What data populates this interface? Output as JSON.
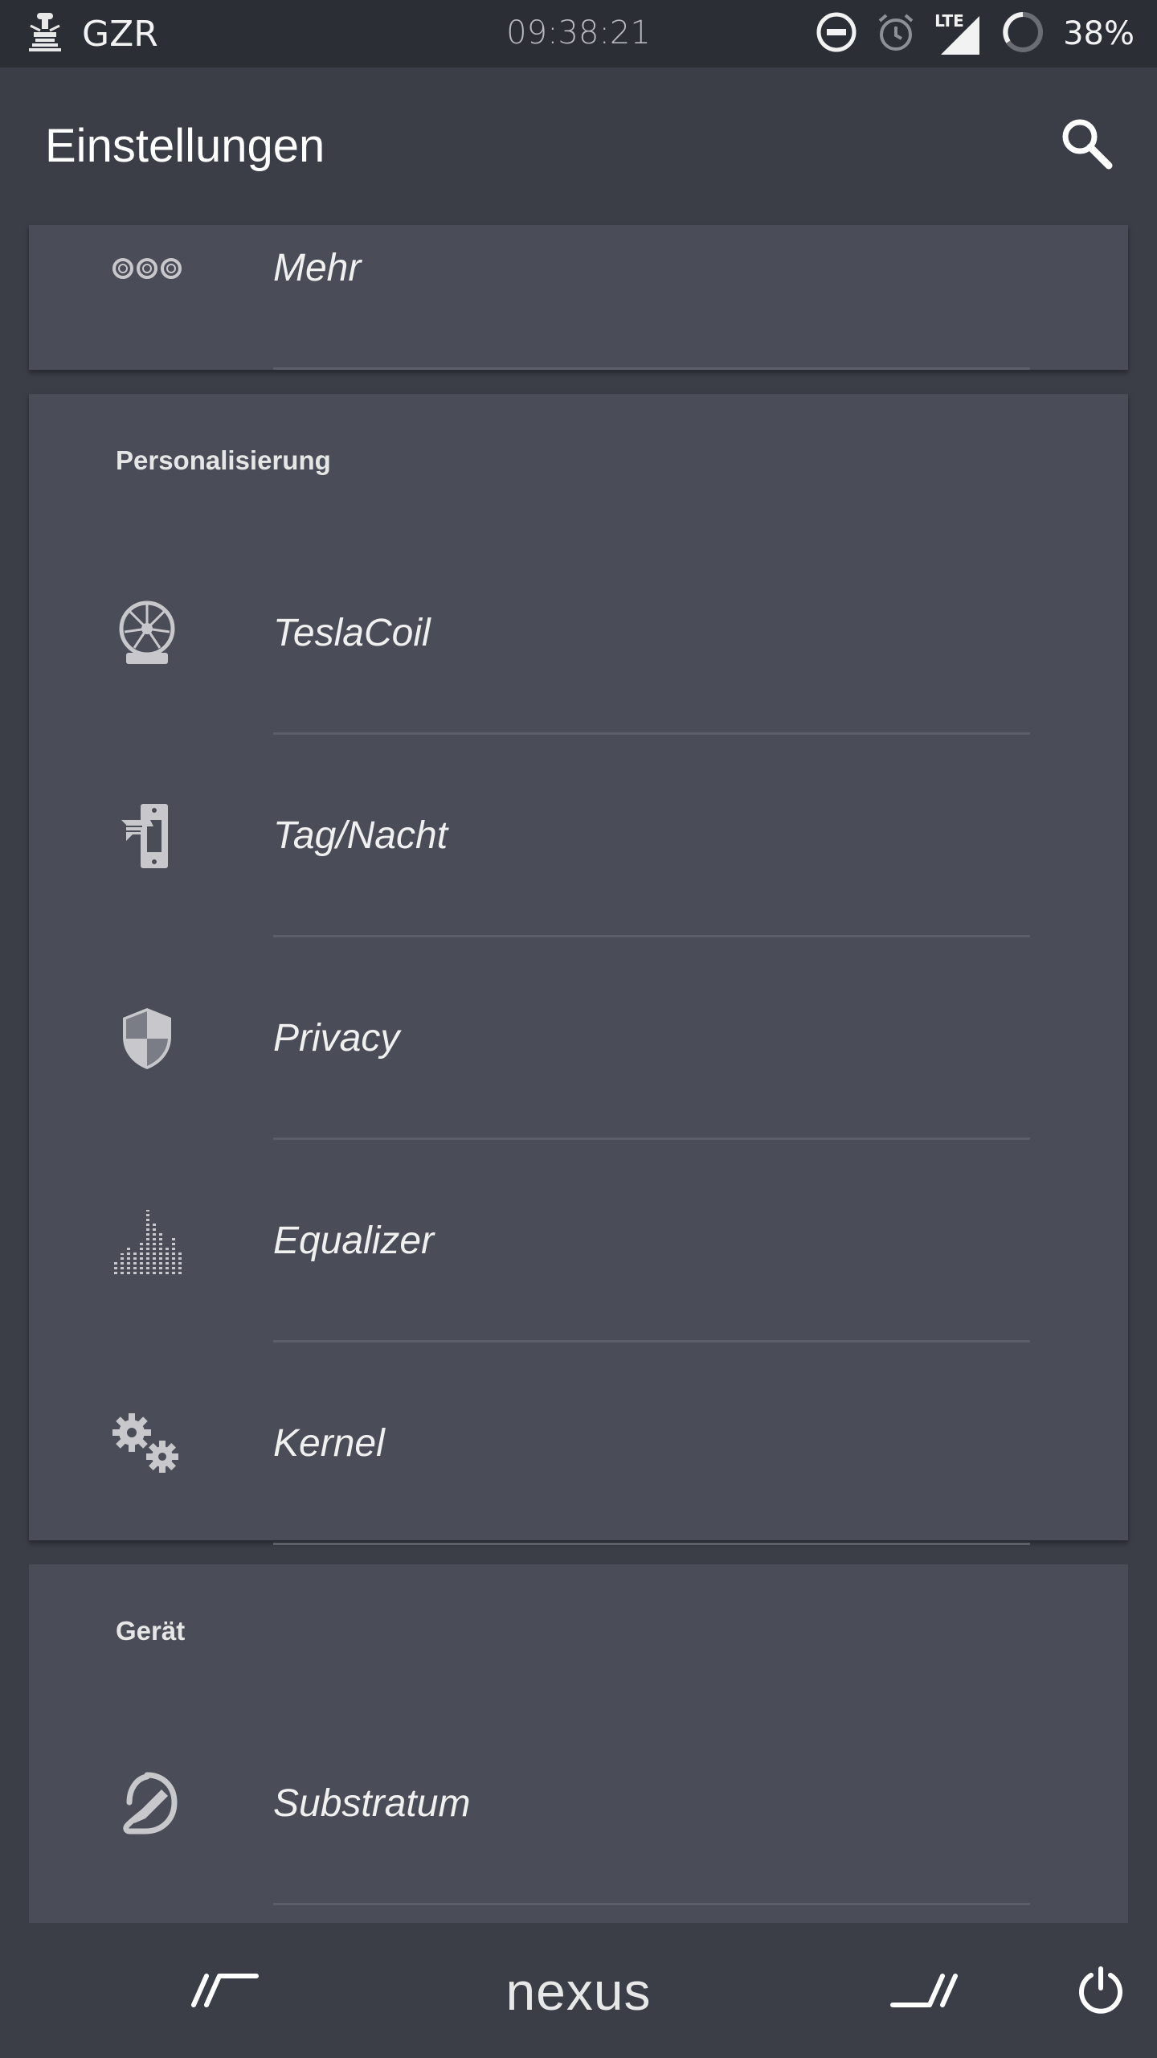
{
  "status_bar": {
    "carrier": "GZR",
    "time": "09:38:21",
    "network": "LTE",
    "battery": "38%"
  },
  "toolbar": {
    "title": "Einstellungen"
  },
  "top_card": {
    "items": [
      {
        "label": "Mehr",
        "icon": "more-circles-icon"
      }
    ]
  },
  "sections": [
    {
      "header": "Personalisierung",
      "items": [
        {
          "label": "TeslaCoil",
          "icon": "tesla-coil-icon"
        },
        {
          "label": "Tag/Nacht",
          "icon": "day-night-switch-icon"
        },
        {
          "label": "Privacy",
          "icon": "shield-icon"
        },
        {
          "label": "Equalizer",
          "icon": "equalizer-icon"
        },
        {
          "label": "Kernel",
          "icon": "gears-icon"
        }
      ]
    },
    {
      "header": "Gerät",
      "items": [
        {
          "label": "Substratum",
          "icon": "substratum-icon"
        }
      ]
    }
  ],
  "nav_bar": {
    "logo": "nexus",
    "buttons": [
      "back-icon",
      "nexus-logo",
      "recents-icon",
      "power-icon"
    ]
  },
  "colors": {
    "background": "#3b3d47",
    "card": "#4a4c58",
    "status_bar": "#2c2e36",
    "icon": "#c8c8cc"
  }
}
